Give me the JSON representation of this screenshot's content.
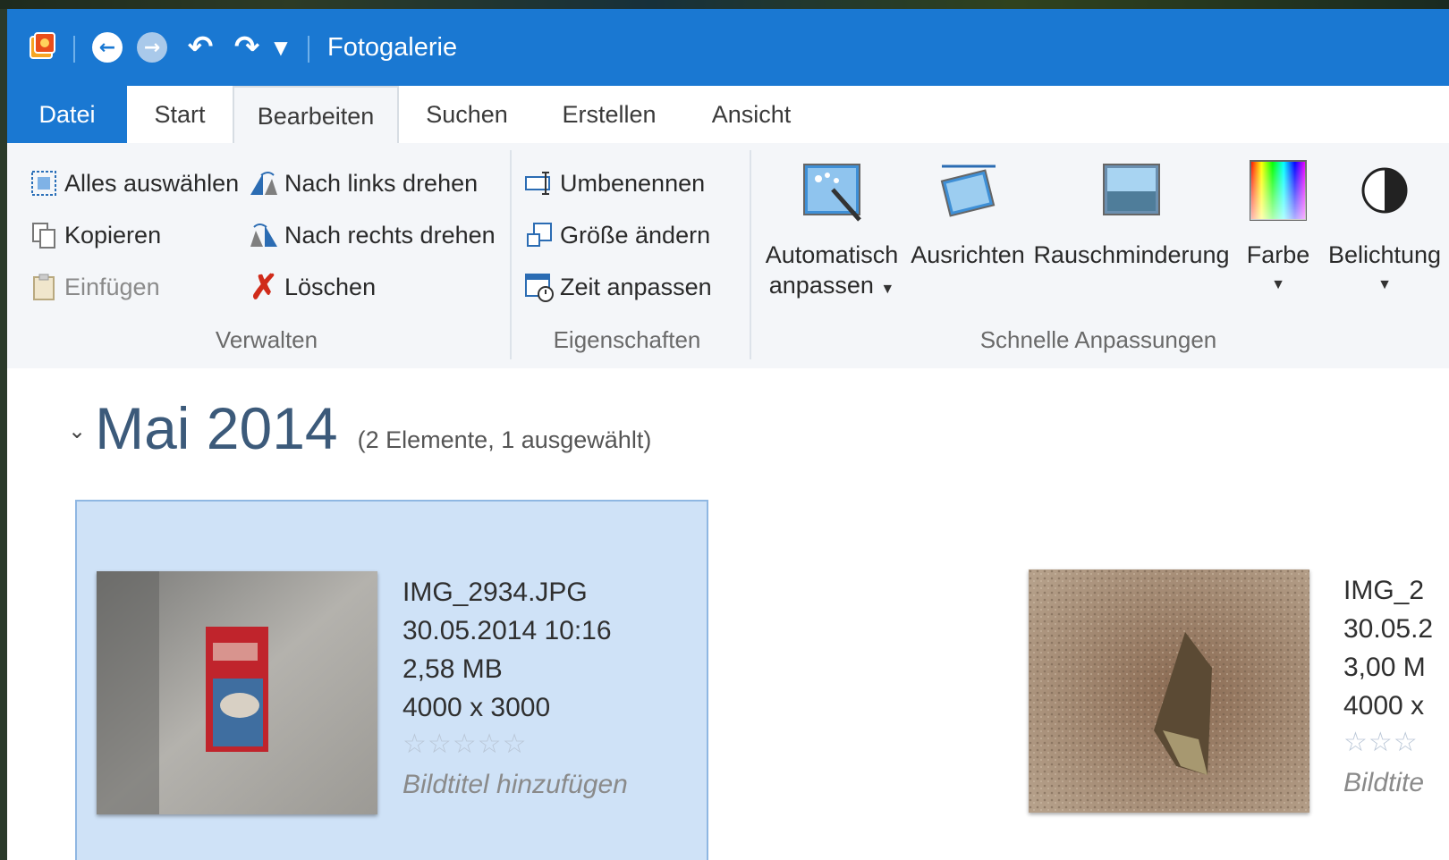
{
  "window": {
    "title": "Fotogalerie"
  },
  "quick_access": {
    "app_icon": "photo-gallery-icon",
    "back_icon": "back-arrow-icon",
    "forward_icon": "forward-arrow-icon",
    "undo_icon": "undo-icon",
    "redo_icon": "redo-icon",
    "customize_icon": "dropdown-icon"
  },
  "tabs": [
    {
      "label": "Datei"
    },
    {
      "label": "Start"
    },
    {
      "label": "Bearbeiten"
    },
    {
      "label": "Suchen"
    },
    {
      "label": "Erstellen"
    },
    {
      "label": "Ansicht"
    }
  ],
  "ribbon": {
    "verwalten": {
      "label": "Verwalten",
      "select_all": "Alles auswählen",
      "copy": "Kopieren",
      "paste": "Einfügen",
      "rotate_left": "Nach links drehen",
      "rotate_right": "Nach rechts drehen",
      "delete": "Löschen"
    },
    "eigenschaften": {
      "label": "Eigenschaften",
      "rename": "Umbenennen",
      "resize": "Größe ändern",
      "adjust_time": "Zeit anpassen"
    },
    "schnelle": {
      "label": "Schnelle Anpassungen",
      "auto_adjust_1": "Automatisch",
      "auto_adjust_2": "anpassen",
      "straighten": "Ausrichten",
      "noise": "Rauschminderung",
      "color": "Farbe",
      "exposure": "Belichtung"
    }
  },
  "group": {
    "title": "Mai 2014",
    "count": "(2 Elemente, 1 ausgewählt)"
  },
  "items": [
    {
      "filename": "IMG_2934.JPG",
      "date": "30.05.2014 10:16",
      "size": "2,58 MB",
      "dimensions": "4000 x 3000",
      "rating": "☆☆☆☆☆",
      "caption": "Bildtitel hinzufügen"
    },
    {
      "filename": "IMG_2",
      "date": "30.05.2",
      "size": "3,00 M",
      "dimensions": "4000 x",
      "rating": "☆☆☆",
      "caption": "Bildtite"
    }
  ],
  "colors": {
    "accent": "#1a78d2",
    "ribbon_bg": "#f4f6f9",
    "selection": "#cfe2f7"
  }
}
